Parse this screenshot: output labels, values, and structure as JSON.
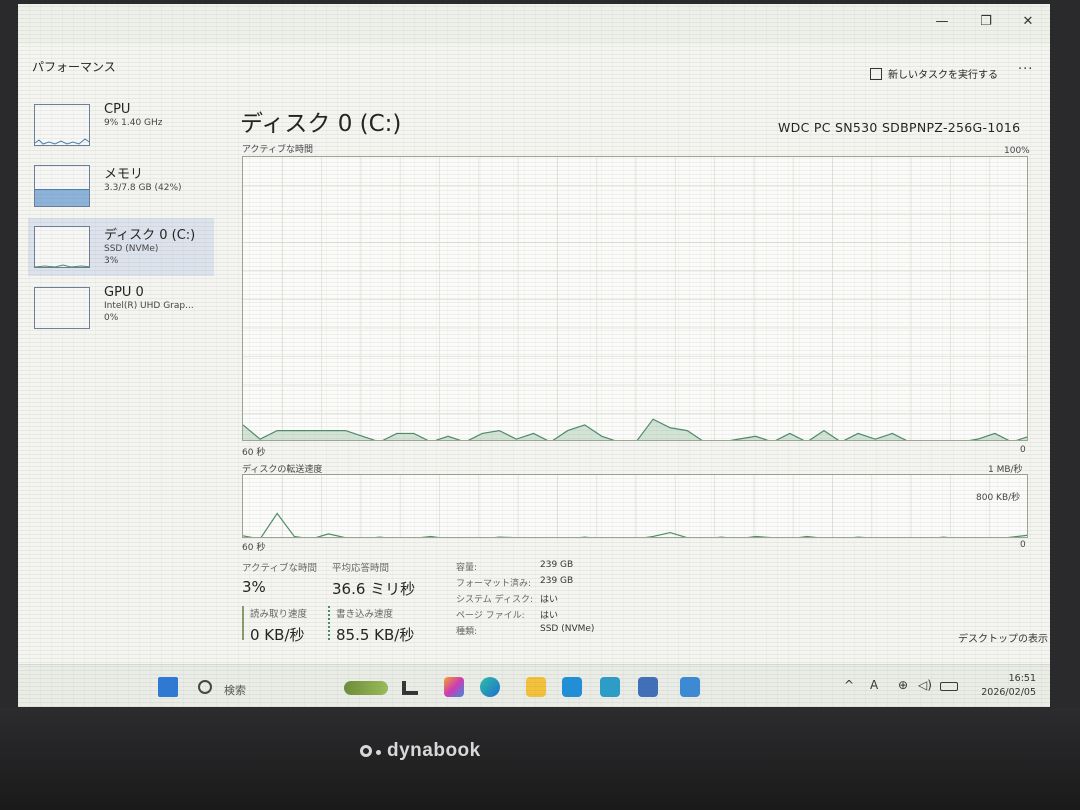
{
  "window": {
    "minimize_glyph": "—",
    "restore_glyph": "❐",
    "close_glyph": "✕"
  },
  "app": {
    "section_title": "パフォーマンス",
    "run_task_label": "新しいタスクを実行する",
    "more_glyph": "···"
  },
  "sidebar": {
    "items": [
      {
        "name": "CPU",
        "sub1": "9% 1.40 GHz",
        "sub2": "",
        "active": false
      },
      {
        "name": "メモリ",
        "sub1": "3.3/7.8 GB (42%)",
        "sub2": "",
        "active": false,
        "fill_percent": 42
      },
      {
        "name": "ディスク 0 (C:)",
        "sub1": "SSD (NVMe)",
        "sub2": "3%",
        "active": true
      },
      {
        "name": "GPU 0",
        "sub1": "Intel(R) UHD Grap...",
        "sub2": "0%",
        "active": false
      }
    ]
  },
  "main": {
    "title": "ディスク 0 (C:)",
    "model": "WDC PC SN530 SDBPNPZ-256G-1016",
    "active_time_graph": {
      "label": "アクティブな時間",
      "max_label": "100%",
      "left_label": "60 秒",
      "right_label": "0",
      "values": [
        6,
        1,
        4,
        4,
        4,
        4,
        4,
        2,
        0,
        3,
        3,
        0,
        2,
        0,
        3,
        4,
        1,
        3,
        0,
        4,
        6,
        2,
        0,
        0,
        8,
        5,
        4,
        0,
        0,
        1,
        2,
        0,
        3,
        0,
        4,
        0,
        3,
        1,
        3,
        0,
        0,
        0,
        0,
        1,
        3,
        0,
        2
      ]
    },
    "transfer_graph": {
      "label": "ディスクの転送速度",
      "max_label": "1 MB/秒",
      "secondary_label": "800 KB/秒",
      "left_label": "60 秒",
      "right_label": "0",
      "values": [
        5,
        0,
        40,
        4,
        0,
        8,
        2,
        0,
        3,
        0,
        1,
        4,
        0,
        2,
        0,
        3,
        2,
        0,
        2,
        0,
        3,
        0,
        1,
        0,
        4,
        10,
        2,
        0,
        3,
        0,
        4,
        2,
        0,
        4,
        1,
        0,
        3,
        1,
        0,
        2,
        0,
        3,
        0,
        1,
        0,
        3,
        6
      ]
    },
    "stats": {
      "active_time_label": "アクティブな時間",
      "active_time_value": "3%",
      "avg_response_label": "平均応答時間",
      "avg_response_value": "36.6 ミリ秒",
      "read_speed_label": "読み取り速度",
      "read_speed_value": "0 KB/秒",
      "write_speed_label": "書き込み速度",
      "write_speed_value": "85.5 KB/秒"
    },
    "info": {
      "capacity_label": "容量:",
      "capacity_value": "239 GB",
      "formatted_label": "フォーマット済み:",
      "formatted_value": "239 GB",
      "system_disk_label": "システム ディスク:",
      "system_disk_value": "はい",
      "page_file_label": "ページ ファイル:",
      "page_file_value": "はい",
      "type_label": "種類:",
      "type_value": "SSD (NVMe)"
    },
    "show_desktop": "デスクトップの表示"
  },
  "taskbar": {
    "search_placeholder": "検索",
    "ime_label": "A",
    "time": "16:51",
    "date": "2026/02/05"
  },
  "colors": {
    "graph_line": "#4f8a6a",
    "graph_fill": "#d3e4d7",
    "write_bar": "#4f8a6a",
    "read_bar": "#8a9a6a",
    "sidebar_active": "#dde3ec"
  },
  "bezel": {
    "brand": "dynabook"
  }
}
